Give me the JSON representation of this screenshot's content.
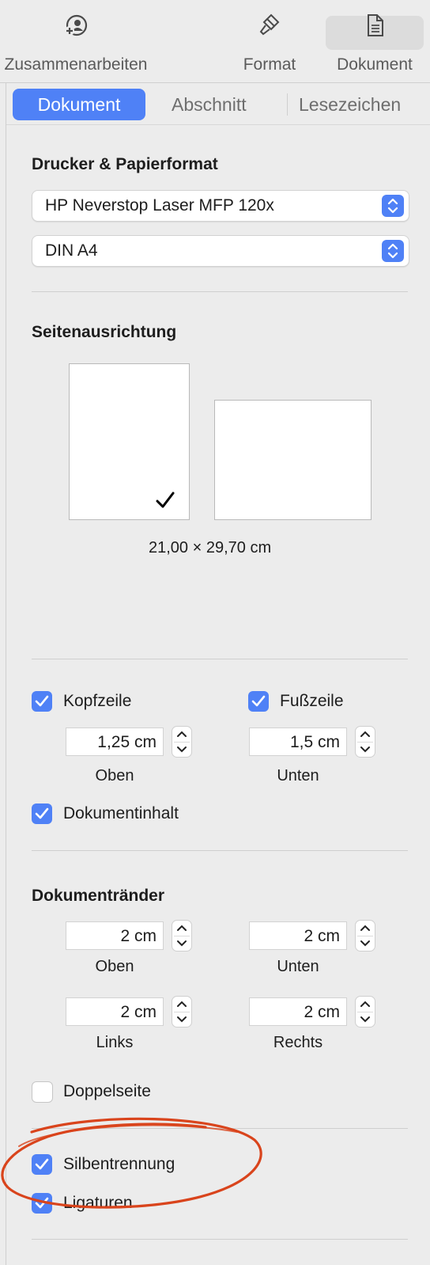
{
  "toolbar": {
    "collaborate": "Zusammenarbeiten",
    "format": "Format",
    "document": "Dokument",
    "icons": {
      "collaborate": "person-plus-icon",
      "format": "paintbrush-icon",
      "document": "document-icon"
    }
  },
  "tabs": {
    "active": "Dokument",
    "section": "Abschnitt",
    "bookmarks": "Lesezeichen"
  },
  "printer": {
    "heading": "Drucker & Papierformat",
    "printer_value": "HP Neverstop Laser MFP 120x",
    "paper_value": "DIN A4"
  },
  "orientation": {
    "heading": "Seitenausrichtung",
    "selected": "portrait",
    "size": "21,00 × 29,70 cm"
  },
  "header_footer": {
    "header_label": "Kopfzeile",
    "header_checked": true,
    "header_value": "1,25 cm",
    "header_sub": "Oben",
    "footer_label": "Fußzeile",
    "footer_checked": true,
    "footer_value": "1,5 cm",
    "footer_sub": "Unten",
    "body_label": "Dokumentinhalt",
    "body_checked": true
  },
  "margins": {
    "heading": "Dokumentränder",
    "top_value": "2 cm",
    "top_label": "Oben",
    "bottom_value": "2 cm",
    "bottom_label": "Unten",
    "left_value": "2 cm",
    "left_label": "Links",
    "right_value": "2 cm",
    "right_label": "Rechts"
  },
  "options": {
    "facing_label": "Doppelseite",
    "facing_checked": false,
    "hyphenation_label": "Silbentrennung",
    "hyphenation_checked": true,
    "ligatures_label": "Ligaturen",
    "ligatures_checked": true
  },
  "colors": {
    "accent": "#4f81f6",
    "annotation": "#d9441c"
  }
}
